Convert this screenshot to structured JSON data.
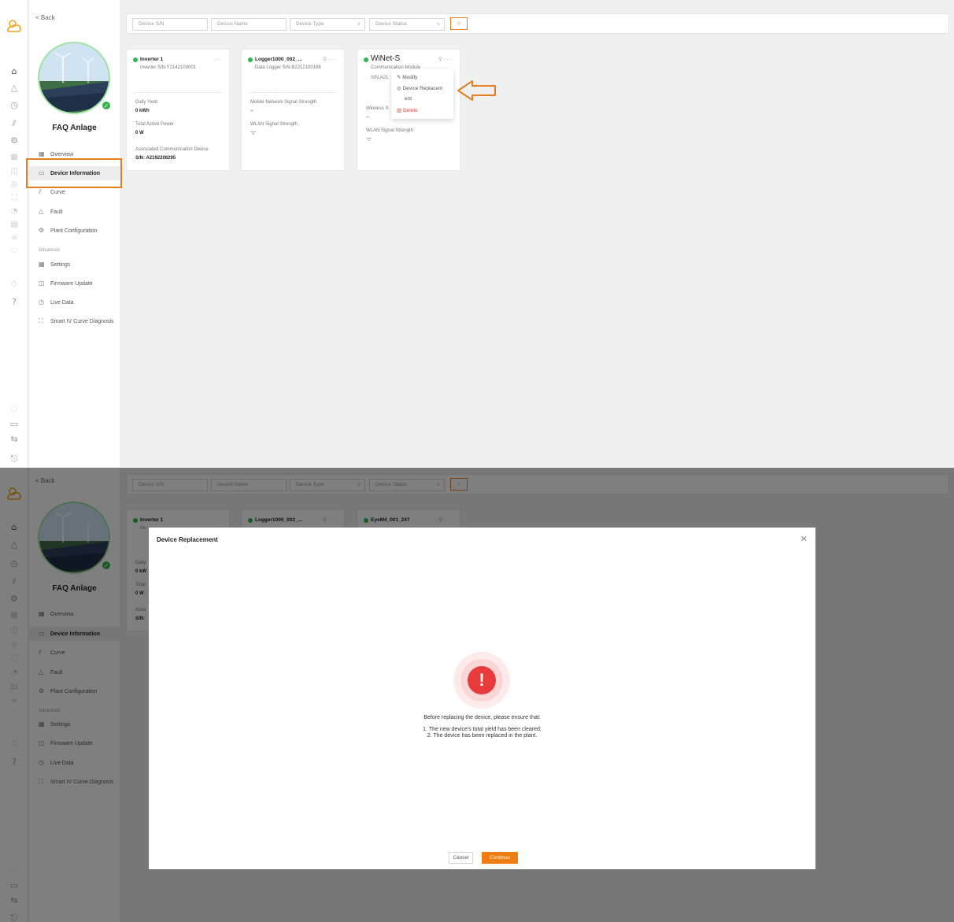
{
  "nav": {
    "back_label": "< Back",
    "plant_name": "FAQ Anlage",
    "items": [
      {
        "label": "Overview",
        "icon": "grid-icon"
      },
      {
        "label": "Device Information",
        "icon": "device-info-icon"
      },
      {
        "label": "Curve",
        "icon": "curve-icon"
      },
      {
        "label": "Fault",
        "icon": "warning-icon"
      },
      {
        "label": "Plant Configuration",
        "icon": "gear-icon"
      }
    ],
    "advanced_label": "Advanced",
    "advanced_items": [
      {
        "label": "Settings",
        "icon": "settings-icon"
      },
      {
        "label": "Firmware Update",
        "icon": "firmware-icon"
      },
      {
        "label": "Live Data",
        "icon": "clock-icon"
      },
      {
        "label": "Smart IV Curve Diagnosis",
        "icon": "scan-icon"
      }
    ],
    "active_item": "Device Information"
  },
  "search": {
    "device_sn_placeholder": "Device S/N",
    "device_name_placeholder": "Device Name",
    "device_type_placeholder": "Device Type",
    "device_status_placeholder": "Device Status"
  },
  "cards": {
    "inverter": {
      "name": "Inverter 1",
      "subtitle": "Inverter  S/N:Y2142100001",
      "daily_yield_label": "Daily Yield",
      "daily_yield_value": "0 kWh",
      "total_power_label": "Total Active Power",
      "total_power_value": "0 W",
      "assoc_label": "Associated Communication Device",
      "assoc_value": "S/N: A2192208295"
    },
    "logger": {
      "name": "Logger1000_002_...",
      "subtitle": "Data Logger  S/N:B2212100188",
      "mobile_label": "Mobile Network Signal Strength",
      "mobile_value": "--",
      "wlan_label": "WLAN Signal Strength"
    },
    "winet": {
      "name": "WiNet-S",
      "subtitle": "Communication Module",
      "sn": "S/N:A21",
      "wireless_label": "Wireless S",
      "wireless_value": "--",
      "wlan_label": "WLAN Signal Strength"
    },
    "bottom_names": [
      "Inverter 1",
      "Logger1000_002_...",
      "EyeM4_001_247"
    ],
    "bottom_sub_fragment": "Inv",
    "bottom_frag": [
      "Daily",
      "0 kW",
      "Total",
      "0 W",
      "Asso",
      "S/N:"
    ]
  },
  "context_menu": {
    "modify": "Modify",
    "replace_line1": "Device Replacem",
    "replace_line2": "ent",
    "delete": "Delete"
  },
  "modal": {
    "title": "Device Replacement",
    "intro": "Before replacing the device, please ensure that:",
    "line1": "1. The new device's total yield has been cleared;",
    "line2": "2. The device has been replaced in the plant.",
    "cancel": "Cancel",
    "continue": "Continue"
  },
  "colors": {
    "accent": "#f07d12",
    "online": "#2db84d",
    "danger": "#e83a3a"
  }
}
